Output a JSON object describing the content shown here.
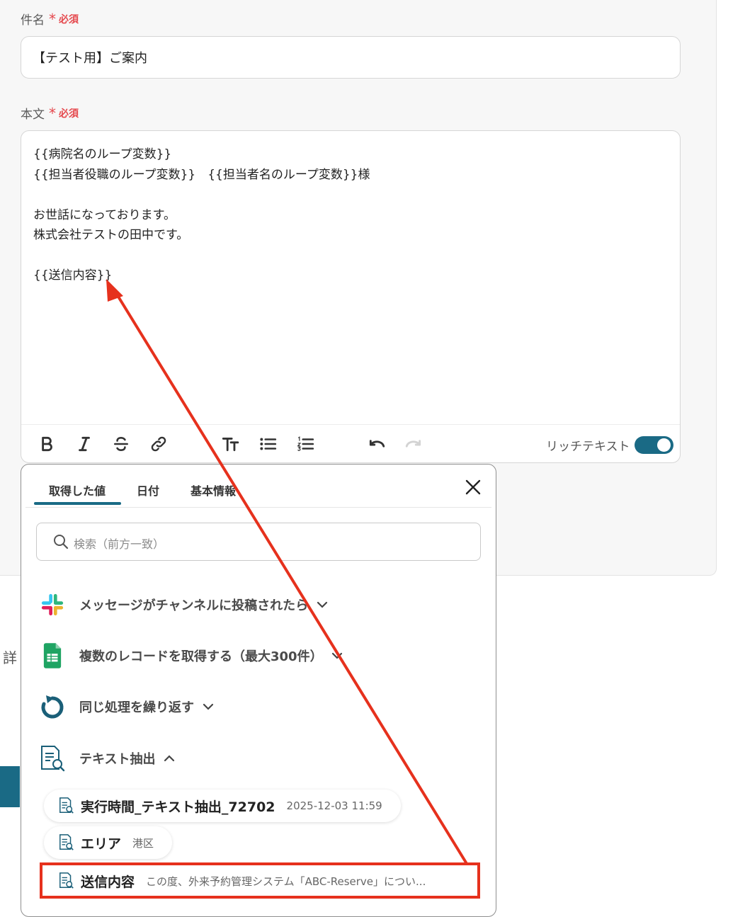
{
  "subject": {
    "label": "件名",
    "asterisk": "*",
    "required": "必須",
    "value": "【テスト用】ご案内"
  },
  "body": {
    "label": "本文",
    "asterisk": "*",
    "required": "必須",
    "text": "{{病院名のループ変数}}\n{{担当者役職のループ変数}}　{{担当者名のループ変数}}様\n\nお世話になっております。\n株式会社テストの田中です。\n\n{{送信内容}}",
    "rich_text_label": "リッチテキスト",
    "rich_text_on": true
  },
  "toolbar": {
    "icons": [
      "bold-icon",
      "italic-icon",
      "strikethrough-icon",
      "link-icon",
      "text-size-icon",
      "bullet-list-icon",
      "numbered-list-icon",
      "undo-icon",
      "redo-icon"
    ]
  },
  "panel": {
    "tabs": [
      "取得した値",
      "日付",
      "基本情報"
    ],
    "active_tab": 0,
    "search_placeholder": "検索（前方一致）",
    "groups": [
      {
        "label": "メッセージがチャンネルに投稿されたら",
        "icon": "slack-icon",
        "expanded": false
      },
      {
        "label": "複数のレコードを取得する（最大300件）",
        "icon": "google-sheets-icon",
        "expanded": false
      },
      {
        "label": "同じ処理を繰り返す",
        "icon": "loop-icon",
        "expanded": false
      },
      {
        "label": "テキスト抽出",
        "icon": "text-extract-icon",
        "expanded": true
      }
    ],
    "items": [
      {
        "key": "実行時間_テキスト抽出_72702",
        "value": "2025-12-03 11:59"
      },
      {
        "key": "エリア",
        "value": "港区"
      },
      {
        "key": "送信内容",
        "value": "この度、外来予約管理システム「ABC-Reserve」につい..."
      }
    ]
  },
  "background": {
    "partial_label": "詳"
  },
  "colors": {
    "accent": "#1a6a85",
    "required": "#e5484d",
    "annotation": "#e6311d"
  }
}
